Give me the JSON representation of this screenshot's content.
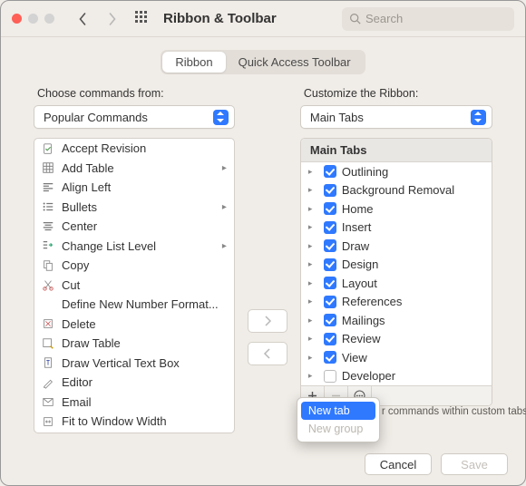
{
  "window_title": "Ribbon & Toolbar",
  "search_placeholder": "Search",
  "segments": {
    "ribbon": "Ribbon",
    "qat": "Quick Access Toolbar"
  },
  "left": {
    "label": "Choose commands from:",
    "select_value": "Popular Commands",
    "commands": [
      {
        "name": "Accept Revision",
        "icon": "accept-revision-icon"
      },
      {
        "name": "Add Table",
        "icon": "table-icon",
        "sub": true
      },
      {
        "name": "Align Left",
        "icon": "align-left-icon"
      },
      {
        "name": "Bullets",
        "icon": "bullets-icon",
        "sub": true
      },
      {
        "name": "Center",
        "icon": "center-icon"
      },
      {
        "name": "Change List Level",
        "icon": "indent-icon",
        "sub": true
      },
      {
        "name": "Copy",
        "icon": "copy-icon"
      },
      {
        "name": "Cut",
        "icon": "cut-icon"
      },
      {
        "name": "Define New Number Format...",
        "icon": ""
      },
      {
        "name": "Delete",
        "icon": "delete-icon"
      },
      {
        "name": "Draw Table",
        "icon": "draw-table-icon"
      },
      {
        "name": "Draw Vertical Text Box",
        "icon": "textbox-icon"
      },
      {
        "name": "Editor",
        "icon": "editor-icon"
      },
      {
        "name": "Email",
        "icon": "email-icon"
      },
      {
        "name": "Fit to Window Width",
        "icon": "fit-width-icon"
      }
    ]
  },
  "right": {
    "label": "Customize the Ribbon:",
    "select_value": "Main Tabs",
    "header": "Main Tabs",
    "tabs": [
      {
        "name": "Outlining",
        "checked": true
      },
      {
        "name": "Background Removal",
        "checked": true
      },
      {
        "name": "Home",
        "checked": true
      },
      {
        "name": "Insert",
        "checked": true
      },
      {
        "name": "Draw",
        "checked": true
      },
      {
        "name": "Design",
        "checked": true
      },
      {
        "name": "Layout",
        "checked": true
      },
      {
        "name": "References",
        "checked": true
      },
      {
        "name": "Mailings",
        "checked": true
      },
      {
        "name": "Review",
        "checked": true
      },
      {
        "name": "View",
        "checked": true
      },
      {
        "name": "Developer",
        "checked": false
      }
    ],
    "hint": "r commands within custom tabs"
  },
  "popup": {
    "new_tab": "New tab",
    "new_group": "New group"
  },
  "footer": {
    "cancel": "Cancel",
    "save": "Save"
  }
}
